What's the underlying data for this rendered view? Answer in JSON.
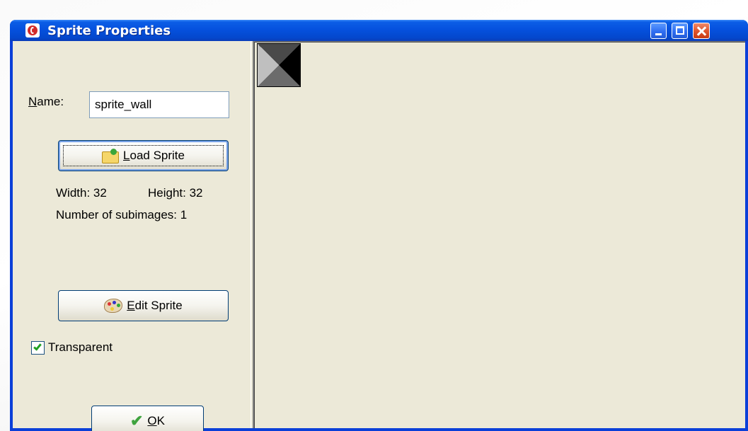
{
  "window": {
    "title": "Sprite Properties"
  },
  "form": {
    "name_label_prefix": "N",
    "name_label_rest": "ame:",
    "name_value": "sprite_wall",
    "load_button": {
      "underline": "L",
      "rest": "oad Sprite"
    },
    "width_text": "Width: 32",
    "height_text": "Height: 32",
    "subimages_text": "Number of subimages: 1",
    "edit_button": {
      "underline": "E",
      "rest": "dit Sprite"
    },
    "transparent_label": "Transparent",
    "transparent_checked": true,
    "ok_button": {
      "underline": "O",
      "rest": "K"
    }
  },
  "icons": {
    "app": "game-maker-icon",
    "load": "folder-open-icon",
    "edit": "palette-icon",
    "ok": "checkmark-icon"
  },
  "colors": {
    "titlebar": "#0551de",
    "client": "#ece9d8",
    "close_button": "#e0562e"
  }
}
